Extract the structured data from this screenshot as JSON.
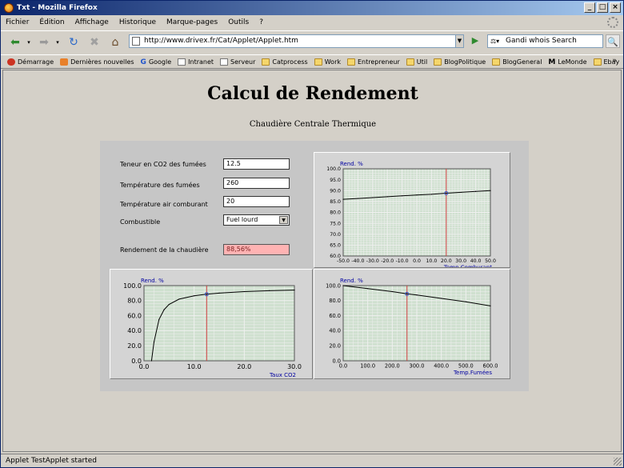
{
  "window": {
    "title": "Txt - Mozilla Firefox"
  },
  "menu": [
    "Fichier",
    "Édition",
    "Affichage",
    "Historique",
    "Marque-pages",
    "Outils",
    "?"
  ],
  "nav": {
    "url": "http://www.drivex.fr/Cat/Applet/Applet.htm",
    "search_text": "Gandi whois Search"
  },
  "bookmarks": [
    {
      "label": "Démarrage",
      "icon": "red-icon"
    },
    {
      "label": "Dernières nouvelles",
      "icon": "feed-icon"
    },
    {
      "label": "Google",
      "icon": "google-icon"
    },
    {
      "label": "Intranet",
      "icon": "page-icon"
    },
    {
      "label": "Serveur",
      "icon": "page-icon"
    },
    {
      "label": "Catprocess",
      "icon": "folder-icon"
    },
    {
      "label": "Work",
      "icon": "folder-icon"
    },
    {
      "label": "Entrepreneur",
      "icon": "folder-icon"
    },
    {
      "label": "Util",
      "icon": "folder-icon"
    },
    {
      "label": "BlogPolitique",
      "icon": "folder-icon"
    },
    {
      "label": "BlogGeneral",
      "icon": "folder-icon"
    },
    {
      "label": "LeMonde",
      "icon": "lemonde-icon"
    },
    {
      "label": "Ebay",
      "icon": "folder-icon"
    }
  ],
  "page": {
    "title": "Calcul de Rendement",
    "subtitle": "Chaudière Centrale Thermique"
  },
  "form": {
    "co2_label": "Teneur en CO2 des fumées",
    "co2_value": "12.5",
    "temp_fumees_label": "Température des fumées",
    "temp_fumees_value": "260",
    "temp_air_label": "Température air comburant",
    "temp_air_value": "20",
    "combustible_label": "Combustible",
    "combustible_value": "Fuel lourd",
    "rendement_label": "Rendement de la chaudière",
    "rendement_value": "88,56%"
  },
  "status": {
    "text": "Applet TestApplet started"
  },
  "colors": {
    "grid_bg": "#cfe0cf",
    "grid_line": "#f0f0f0",
    "marker": "#d04040",
    "curve": "#000000",
    "axis_label": "#0000a0"
  },
  "chart_data": [
    {
      "type": "line",
      "title": "",
      "xlabel": "Temp.Comburant",
      "ylabel": "Rend. %",
      "xlim": [
        -50,
        50
      ],
      "ylim": [
        60,
        100
      ],
      "xticks": [
        "-50.0",
        "-40.0",
        "-30.0",
        "-20.0",
        "-10.0",
        "0.0",
        "10.0",
        "20.0",
        "30.0",
        "40.0",
        "50.0"
      ],
      "yticks": [
        "60.0",
        "65.0",
        "70.0",
        "75.0",
        "80.0",
        "85.0",
        "90.0",
        "95.0",
        "100.0"
      ],
      "x": [
        -50,
        -40,
        -30,
        -20,
        -10,
        0,
        10,
        20,
        30,
        40,
        50
      ],
      "values": [
        86.0,
        86.4,
        86.8,
        87.2,
        87.6,
        88.0,
        88.3,
        88.8,
        89.2,
        89.6,
        90.0
      ],
      "marker_x": 20,
      "grid": true
    },
    {
      "type": "line",
      "title": "",
      "xlabel": "Taux CO2",
      "ylabel": "Rend. %",
      "xlim": [
        0,
        30
      ],
      "ylim": [
        0,
        100
      ],
      "xticks": [
        "0.0",
        "10.0",
        "20.0",
        "30.0"
      ],
      "yticks": [
        "0.0",
        "20.0",
        "40.0",
        "60.0",
        "80.0",
        "100.0"
      ],
      "x": [
        1.5,
        2,
        3,
        4,
        5,
        7,
        10,
        12.5,
        15,
        20,
        25,
        30
      ],
      "values": [
        0,
        25,
        55,
        68,
        75,
        82,
        86.5,
        88.6,
        90,
        92,
        93.2,
        94
      ],
      "marker_x": 12.5,
      "grid": true
    },
    {
      "type": "line",
      "title": "",
      "xlabel": "Temp.Fumées",
      "ylabel": "Rend. %",
      "xlim": [
        0,
        600
      ],
      "ylim": [
        0,
        100
      ],
      "xticks": [
        "0.0",
        "100.0",
        "200.0",
        "300.0",
        "400.0",
        "500.0",
        "600.0"
      ],
      "yticks": [
        "0.0",
        "20.0",
        "40.0",
        "60.0",
        "80.0",
        "100.0"
      ],
      "x": [
        0,
        100,
        200,
        260,
        300,
        400,
        500,
        600
      ],
      "values": [
        100,
        96,
        92,
        89,
        87.5,
        83,
        78.5,
        73
      ],
      "marker_x": 260,
      "grid": true
    }
  ]
}
